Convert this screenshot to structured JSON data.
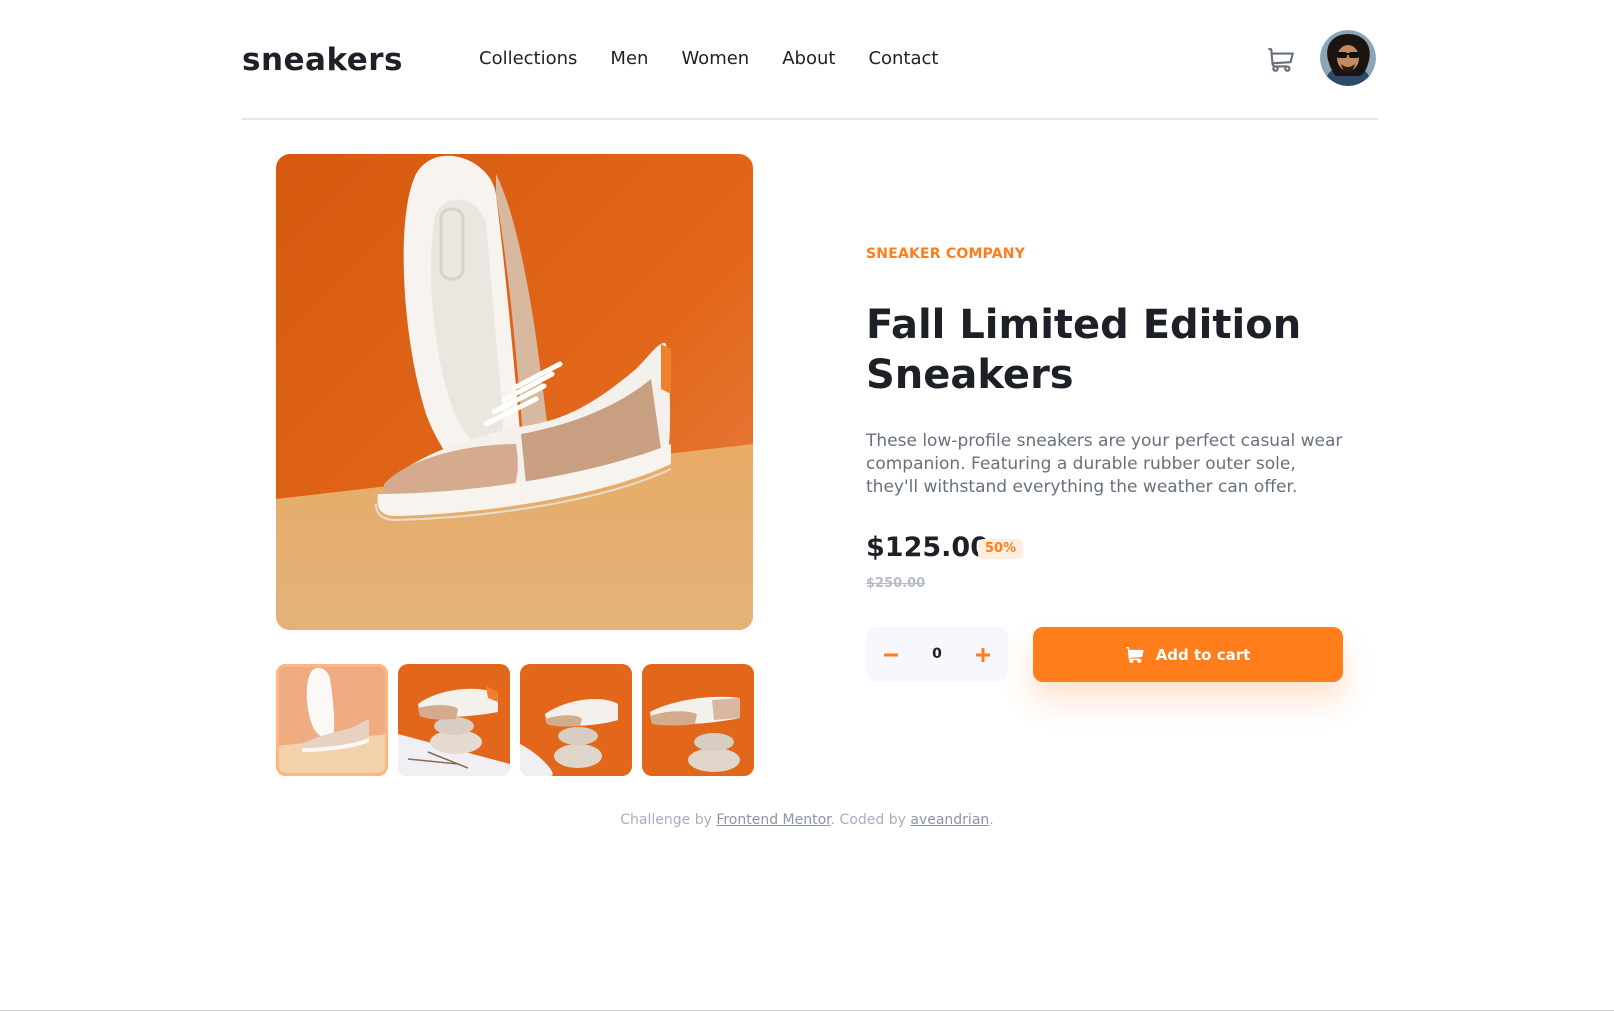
{
  "header": {
    "logo": "sneakers",
    "nav": [
      "Collections",
      "Men",
      "Women",
      "About",
      "Contact"
    ]
  },
  "product": {
    "company": "SNEAKER COMPANY",
    "title": "Fall Limited Edition Sneakers",
    "description": "These low-profile sneakers are your perfect casual wear companion. Featuring a durable rubber outer sole, they'll withstand everything the weather can offer.",
    "price": "$125.00",
    "discount": "50%",
    "old_price": "$250.00",
    "quantity": "0",
    "add_to_cart": "Add to cart",
    "thumbnail_selected": 1
  },
  "footer": {
    "prefix": "Challenge by ",
    "link1": "Frontend Mentor",
    "middle": ". Coded by ",
    "link2": "aveandrian",
    "suffix": "."
  },
  "colors": {
    "accent": "#ff7d1a",
    "accent_pale": "#ffede0",
    "dark": "#1d2026",
    "grey_text": "#68707d"
  },
  "icons": [
    "cart-icon",
    "minus-icon",
    "plus-icon",
    "avatar"
  ]
}
